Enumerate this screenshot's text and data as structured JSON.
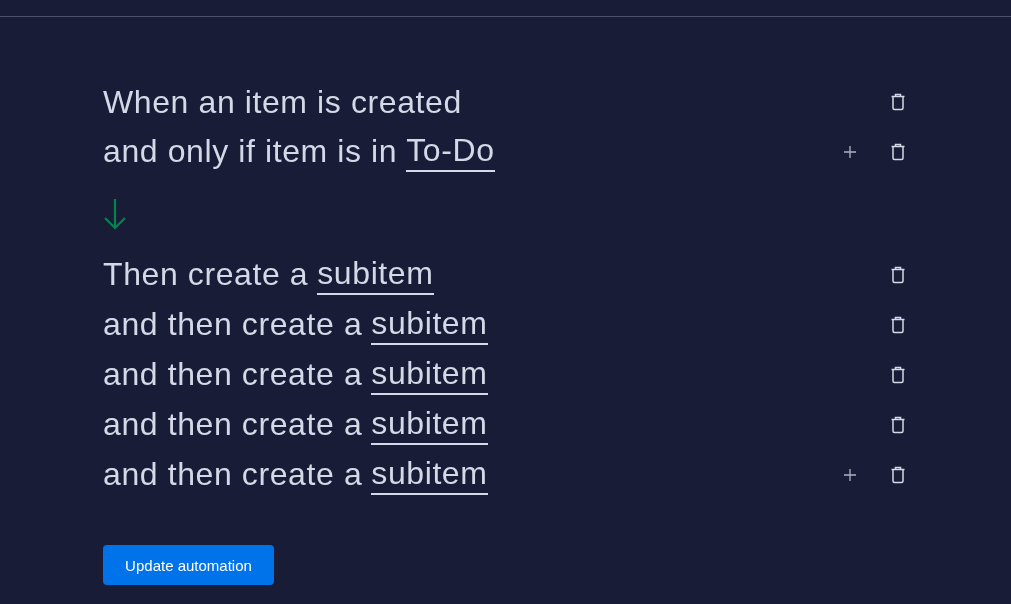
{
  "trigger": [
    {
      "text": "When an item is created",
      "add": false
    },
    {
      "text": "and only if item is in",
      "link": "To-Do",
      "add": true
    }
  ],
  "actions": [
    {
      "text": "Then create a",
      "link": "subitem",
      "add": false
    },
    {
      "text": "and then create a",
      "link": "subitem",
      "add": false
    },
    {
      "text": "and then create a",
      "link": "subitem",
      "add": false
    },
    {
      "text": "and then create a",
      "link": "subitem",
      "add": false
    },
    {
      "text": "and then create a",
      "link": "subitem",
      "add": true
    }
  ],
  "button": "Update automation"
}
